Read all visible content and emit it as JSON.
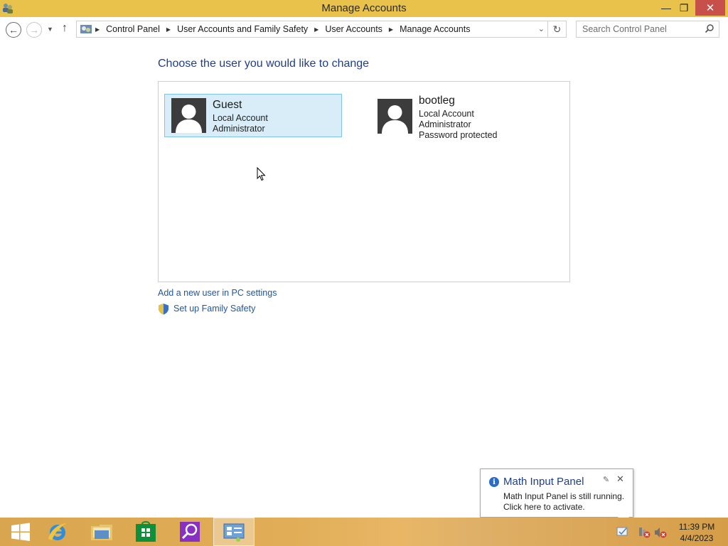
{
  "window": {
    "title": "Manage Accounts"
  },
  "titlebar_buttons": {
    "minimize": "—",
    "maximize": "❐",
    "close": "✕"
  },
  "navigation": {
    "back_icon": "←",
    "forward_icon": "→",
    "dropdown_icon": "▼",
    "up_icon": "↑",
    "breadcrumbs": [
      "Control Panel",
      "User Accounts and Family Safety",
      "User Accounts",
      "Manage Accounts"
    ],
    "breadcrumb_separator": "▶",
    "address_dropdown_icon": "⌄",
    "refresh_icon": "↻",
    "search_placeholder": "Search Control Panel"
  },
  "main": {
    "heading": "Choose the user you would like to change",
    "accounts": [
      {
        "name": "Guest",
        "lines": [
          "Local Account",
          "Administrator"
        ],
        "selected": true
      },
      {
        "name": "bootleg",
        "lines": [
          "Local Account",
          "Administrator",
          "Password protected"
        ],
        "selected": false
      }
    ],
    "add_user_link": "Add a new user in PC settings",
    "family_safety_link": "Set up Family Safety"
  },
  "notification": {
    "title": "Math Input Panel",
    "line1": "Math Input Panel is still running.",
    "line2": "Click here to activate.",
    "info_icon": "i",
    "pin_icon": "✎",
    "close_icon": "✕"
  },
  "taskbar": {
    "items": [
      "start-button",
      "internet-explorer",
      "file-explorer",
      "store",
      "search-app",
      "control-panel"
    ],
    "active_item": "control-panel"
  },
  "clock": {
    "time": "11:39 PM",
    "date": "4/4/2023"
  },
  "colors": {
    "titlebar": "#e9c24c",
    "accent_text": "#1e3f87",
    "link": "#1e57a6",
    "selection_bg": "#d8edf8",
    "selection_border": "#7ec3e8",
    "close_button": "#c7504a"
  }
}
